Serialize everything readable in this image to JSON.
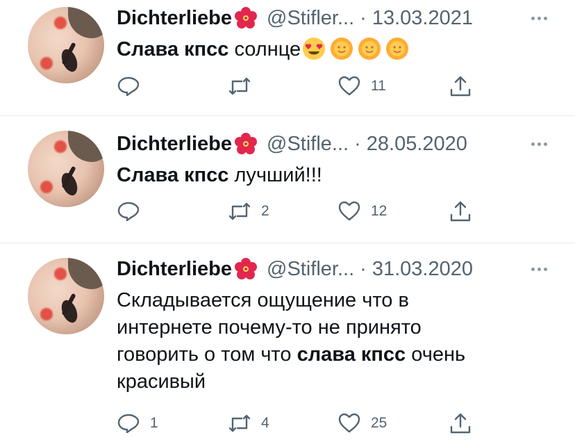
{
  "tweets": [
    {
      "name": "Dichterliebe",
      "name_emoji": "hibiscus-emoji",
      "handle": "@Stifler...",
      "dot": "·",
      "date": "13.03.2021",
      "body_bold": "Слава кпсс",
      "body_rest": " солнце",
      "body_emojis": [
        "heart-eyes-emoji",
        "sun-face-emoji",
        "sun-face-emoji",
        "sun-face-emoji"
      ],
      "actions": {
        "reply": "",
        "retweet": "",
        "like": "11",
        "share": ""
      }
    },
    {
      "name": "Dichterliebe",
      "name_emoji": "hibiscus-emoji",
      "handle": "@Stifle...",
      "dot": "·",
      "date": "28.05.2020",
      "body_bold": "Слава кпсс",
      "body_rest": " лучший!!!",
      "actions": {
        "reply": "",
        "retweet": "2",
        "like": "12",
        "share": ""
      }
    },
    {
      "name": "Dichterliebe",
      "name_emoji": "hibiscus-emoji",
      "handle": "@Stifler...",
      "dot": "·",
      "date": "31.03.2020",
      "body_lines": [
        "Складывается ощущение что в",
        "интернете почему-то не принято"
      ],
      "body_line3_pre": "говорить о том что ",
      "body_line3_bold": "слава кпсс",
      "body_line3_post": " очень",
      "body_line4": "красивый",
      "actions": {
        "reply": "1",
        "retweet": "4",
        "like": "25",
        "share": ""
      }
    }
  ],
  "colors": {
    "text": "#0f1419",
    "secondary": "#536471",
    "divider": "#e6e9eb"
  },
  "icons": [
    "reply-icon",
    "retweet-icon",
    "like-icon",
    "share-icon",
    "more-icon"
  ]
}
